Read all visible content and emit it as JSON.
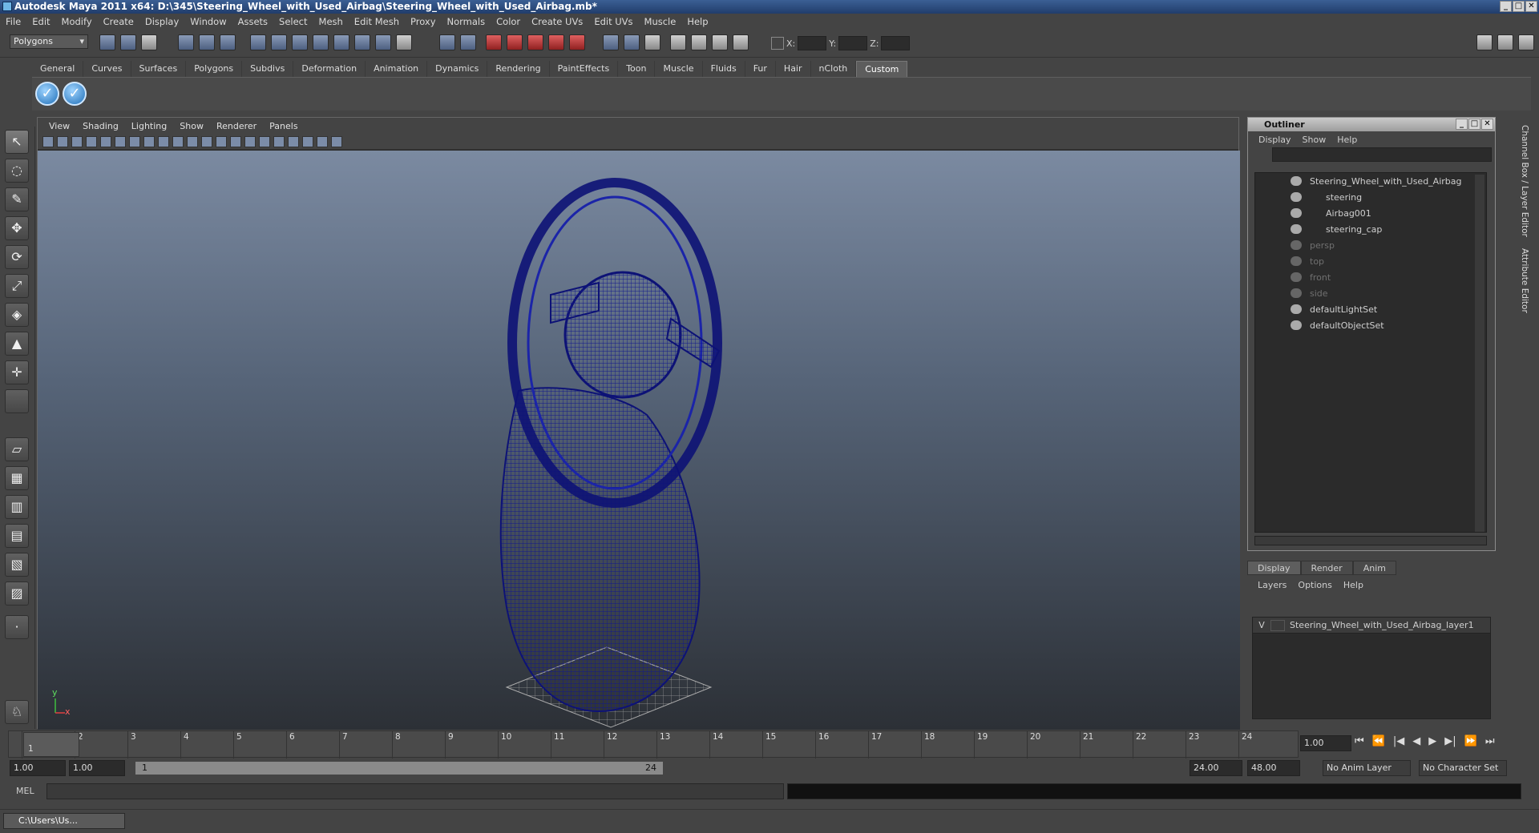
{
  "window": {
    "title": "Autodesk Maya 2011 x64: D:\\345\\Steering_Wheel_with_Used_Airbag\\Steering_Wheel_with_Used_Airbag.mb*",
    "controls": [
      "_",
      "□",
      "✕"
    ]
  },
  "menubar": [
    "File",
    "Edit",
    "Modify",
    "Create",
    "Display",
    "Window",
    "Assets",
    "Select",
    "Mesh",
    "Edit Mesh",
    "Proxy",
    "Normals",
    "Color",
    "Create UVs",
    "Edit UVs",
    "Muscle",
    "Help"
  ],
  "statusline": {
    "mode": "Polygons",
    "coords": {
      "x_label": "X:",
      "y_label": "Y:",
      "z_label": "Z:"
    }
  },
  "shelf": {
    "tabs": [
      "General",
      "Curves",
      "Surfaces",
      "Polygons",
      "Subdivs",
      "Deformation",
      "Animation",
      "Dynamics",
      "Rendering",
      "PaintEffects",
      "Toon",
      "Muscle",
      "Fluids",
      "Fur",
      "Hair",
      "nCloth",
      "Custom"
    ],
    "active_tab": "Custom",
    "button_icon": "✓"
  },
  "viewport": {
    "menu": [
      "View",
      "Shading",
      "Lighting",
      "Show",
      "Renderer",
      "Panels"
    ],
    "axis_x": "x",
    "axis_y": "y",
    "wire_color": "#0d1276"
  },
  "outliner": {
    "title": "Outliner",
    "menu": [
      "Display",
      "Show",
      "Help"
    ],
    "items": [
      {
        "label": "Steering_Wheel_with_Used_Airbag",
        "dim": false
      },
      {
        "label": "steering",
        "dim": false
      },
      {
        "label": "Airbag001",
        "dim": false
      },
      {
        "label": "steering_cap",
        "dim": false
      },
      {
        "label": "persp",
        "dim": true
      },
      {
        "label": "top",
        "dim": true
      },
      {
        "label": "front",
        "dim": true
      },
      {
        "label": "side",
        "dim": true
      },
      {
        "label": "defaultLightSet",
        "dim": false
      },
      {
        "label": "defaultObjectSet",
        "dim": false
      }
    ]
  },
  "layer_editor": {
    "tabs": [
      "Display",
      "Render",
      "Anim"
    ],
    "menu": [
      "Layers",
      "Options",
      "Help"
    ],
    "layer": {
      "visible": "V",
      "name": "Steering_Wheel_with_Used_Airbag_layer1"
    }
  },
  "side_tabs": [
    "Channel Box / Layer Editor",
    "Attribute Editor"
  ],
  "timeline": {
    "ticks": [
      "1",
      "2",
      "3",
      "4",
      "5",
      "6",
      "7",
      "8",
      "9",
      "10",
      "11",
      "12",
      "13",
      "14",
      "15",
      "16",
      "17",
      "18",
      "19",
      "20",
      "21",
      "22",
      "23",
      "24"
    ],
    "current_frame_marker": "1",
    "current_time": "1.00"
  },
  "range": {
    "start": "1.00",
    "anim_start": "1.00",
    "slider_start": "1",
    "slider_end": "24",
    "anim_end": "24.00",
    "end": "48.00",
    "anim_layer": "No Anim Layer",
    "character_set": "No Character Set"
  },
  "command_line": {
    "label": "MEL"
  },
  "taskbar": {
    "task_label": "C:\\Users\\Us..."
  }
}
